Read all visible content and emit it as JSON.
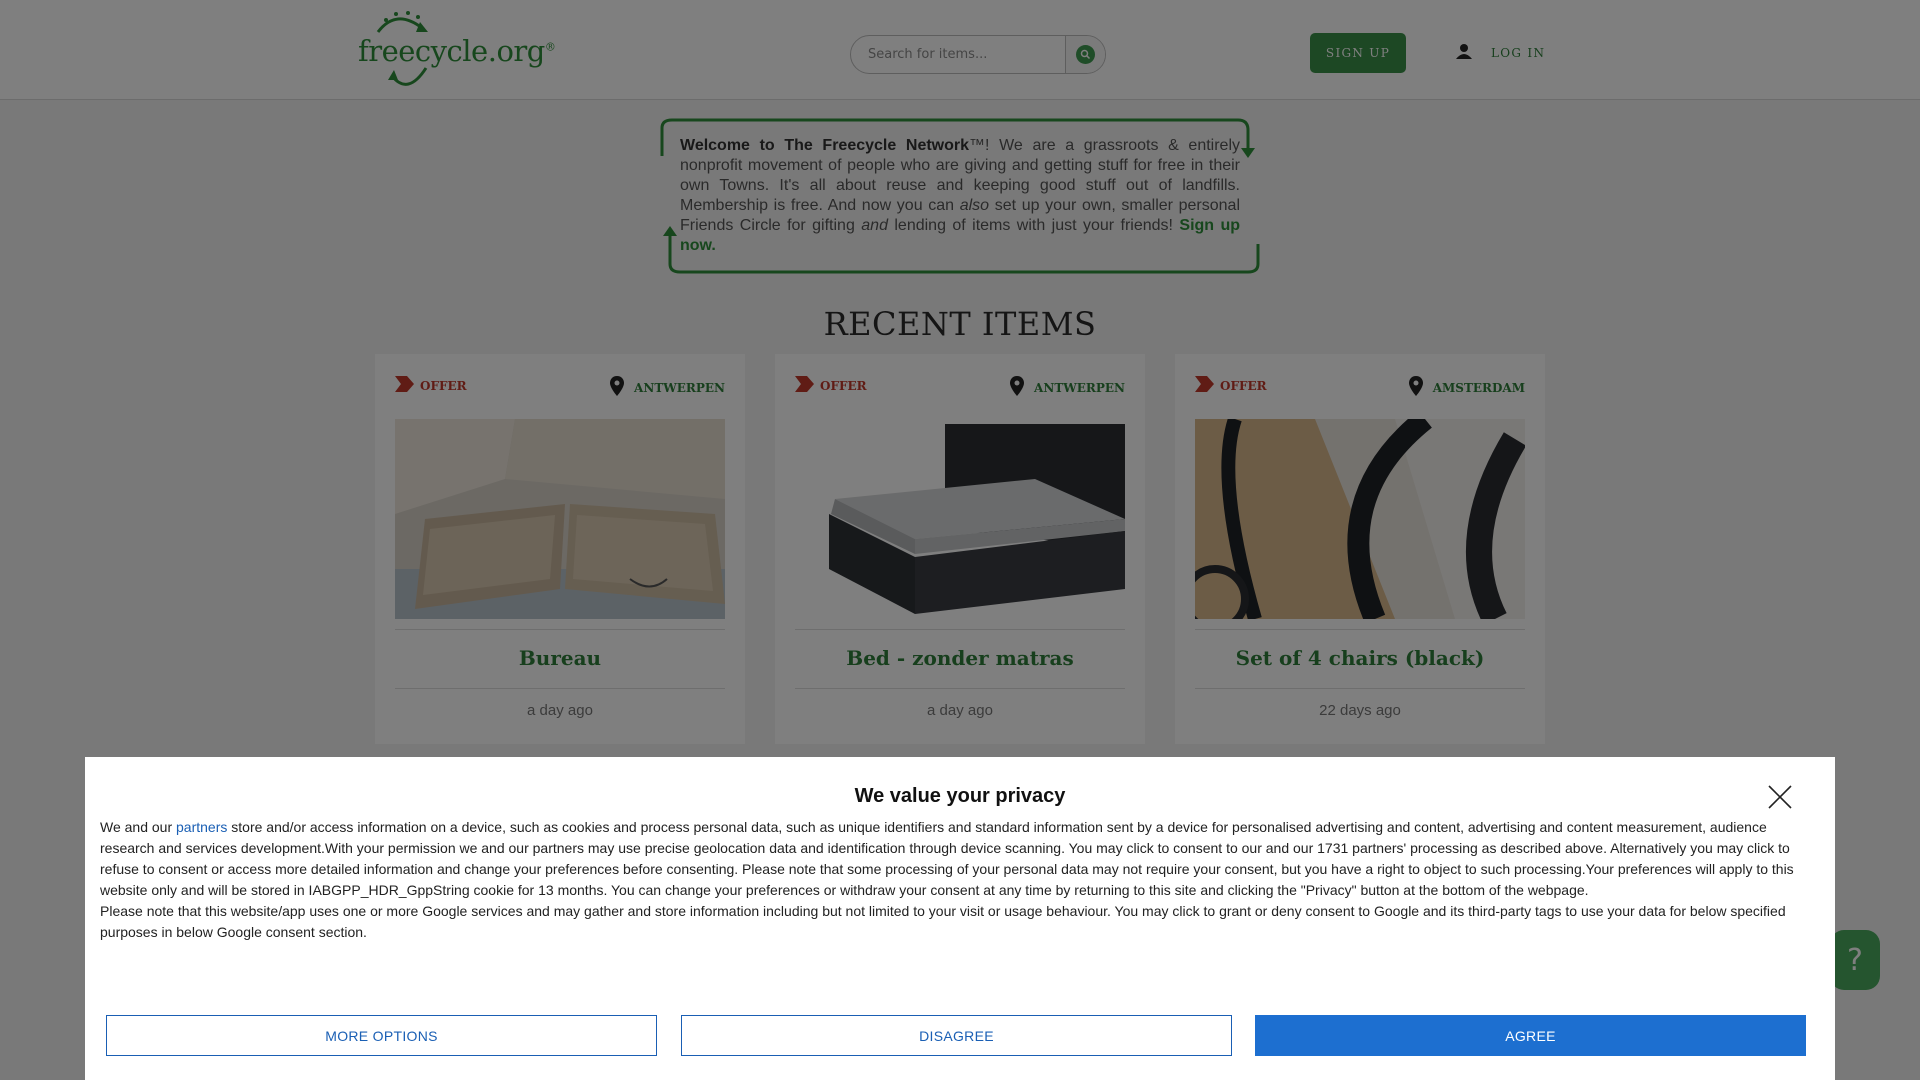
{
  "header": {
    "logo_text": "freecycle.org",
    "logo_reg": "®",
    "search_placeholder": "Search for items...",
    "signup_label": "SIGN UP",
    "login_label": "LOG IN"
  },
  "welcome": {
    "bold": "Welcome to The Freecycle Network",
    "tm": "™",
    "part1": "! We are a grassroots & entirely nonprofit movement of people who are giving and getting stuff for free in their own Towns. It's all about reuse and keeping good stuff out of landfills. Membership is free. And now you can ",
    "also": "also",
    "part2": " set up your own, smaller personal Friends Circle for gifting ",
    "and": "and",
    "part3": " lending of items with just your friends! ",
    "signup_link": "Sign up now."
  },
  "recent_title": "RECENT ITEMS",
  "items": [
    {
      "type": "OFFER",
      "location": "ANTWERPEN",
      "title": "Bureau",
      "time": "a day ago"
    },
    {
      "type": "OFFER",
      "location": "ANTWERPEN",
      "title": "Bed - zonder matras",
      "time": "a day ago"
    },
    {
      "type": "OFFER",
      "location": "AMSTERDAM",
      "title": "Set of 4 chairs (black)",
      "time": "22 days ago"
    }
  ],
  "help_label": "?",
  "consent": {
    "title": "We value your privacy",
    "intro_before": "We and our ",
    "partners_link": "partners",
    "intro_after": " store and/or access information on a device, such as cookies and process personal data, such as unique identifiers and standard information sent by a device for personalised advertising and content, advertising and content measurement, audience research and services development.With your permission we and our partners may use precise geolocation data and identification through device scanning. You may click to consent to our and our 1731 partners' processing as described above. Alternatively you may click to refuse to consent or access more detailed information and change your preferences before consenting. Please note that some processing of your personal data may not require your consent, but you have a right to object to such processing.Your preferences will apply to this website only and will be stored in IABGPP_HDR_GppString cookie for 13 months. You can change your preferences or withdraw your consent at any time by returning to this site and clicking the \"Privacy\" button at the bottom of the webpage.",
    "google_note": "Please note that this website/app uses one or more Google services and may gather and store information including but not limited to your visit or usage behaviour. You may click to grant or deny consent to Google and its third-party tags to use your data for below specified purposes in below Google consent section.",
    "more_options": "MORE OPTIONS",
    "disagree": "DISAGREE",
    "agree": "AGREE"
  },
  "colors": {
    "brand_green": "#3b9149",
    "offer_red": "#c0392b",
    "consent_blue": "#1d6fd0"
  }
}
